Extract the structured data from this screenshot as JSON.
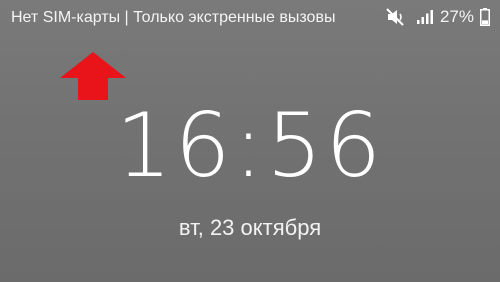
{
  "status_bar": {
    "carrier_text": "Нет SIM-карты | Только экстренные вызовы",
    "battery_percent": "27%",
    "battery_level": 0.27,
    "icons": [
      "mute-icon",
      "signal-icon",
      "battery-icon"
    ]
  },
  "annotation": {
    "icon": "arrow-up-icon",
    "color": "#e8141a"
  },
  "lock_screen": {
    "time": "16:56",
    "date": "вт, 23 октября"
  },
  "colors": {
    "background": "#737373",
    "text": "#ffffff"
  }
}
